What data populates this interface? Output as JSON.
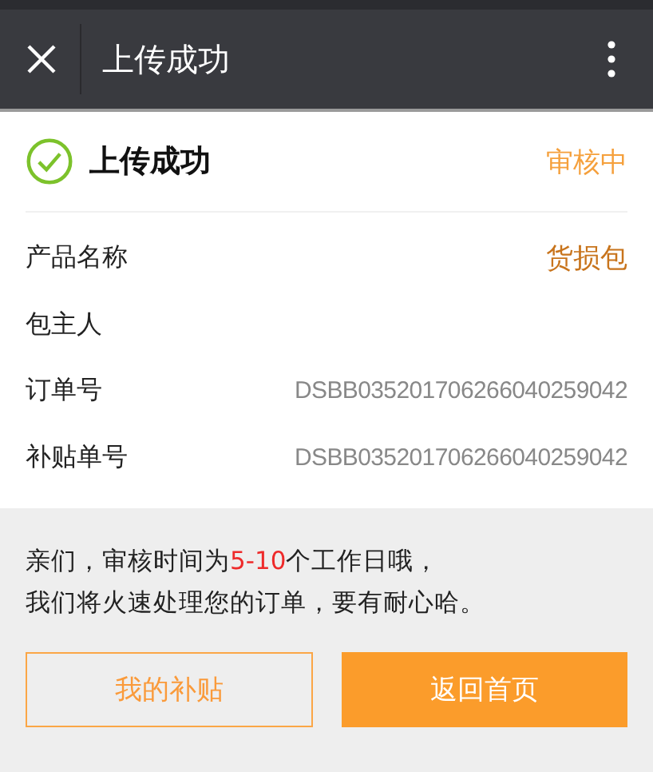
{
  "title_bar": {
    "title": "上传成功"
  },
  "status": {
    "title": "上传成功",
    "state": "审核中"
  },
  "details": [
    {
      "label": "产品名称",
      "value": "货损包",
      "kind": "highlight"
    },
    {
      "label": "包主人"
    },
    {
      "label": "订单号",
      "value": "DSBB035201706266040259042",
      "kind": "plain"
    },
    {
      "label": "补贴单号",
      "value": "DSBB035201706266040259042",
      "kind": "plain"
    }
  ],
  "notice": [
    [
      {
        "text": "亲们，审核时间为",
        "highlight": false
      },
      {
        "text": "5-10",
        "highlight": true
      },
      {
        "text": "个工作日哦，",
        "highlight": false
      }
    ],
    [
      {
        "text": "我们将火速处理您的订单，要有耐心哈。",
        "highlight": false
      }
    ]
  ],
  "buttons": [
    {
      "label": "我的补贴",
      "kind": "outline"
    },
    {
      "label": "返回首页",
      "kind": "filled"
    }
  ]
}
